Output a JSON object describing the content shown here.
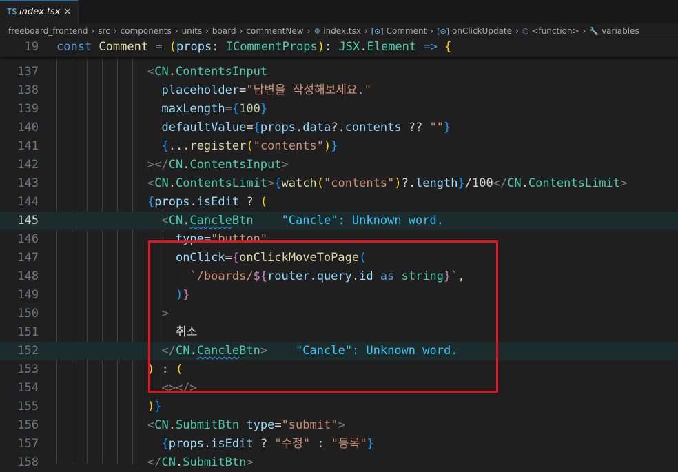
{
  "tab": {
    "icon": "TS",
    "title": "index.tsx",
    "close": "×"
  },
  "breadcrumb": [
    {
      "label": "freeboard_frontend",
      "icon": ""
    },
    {
      "label": "src",
      "icon": ""
    },
    {
      "label": "components",
      "icon": ""
    },
    {
      "label": "units",
      "icon": ""
    },
    {
      "label": "board",
      "icon": ""
    },
    {
      "label": "commentNew",
      "icon": ""
    },
    {
      "label": "index.tsx",
      "icon": "⚙"
    },
    {
      "label": "Comment",
      "icon": "[⊙]"
    },
    {
      "label": "onClickUpdate",
      "icon": "[⊙]"
    },
    {
      "label": "<function>",
      "icon": "⬡"
    },
    {
      "label": "variables",
      "icon": "🔧"
    }
  ],
  "editor": {
    "line_numbers": [
      "19",
      "137",
      "138",
      "139",
      "140",
      "141",
      "142",
      "143",
      "144",
      "145",
      "146",
      "147",
      "148",
      "149",
      "150",
      "151",
      "152",
      "153",
      "154",
      "155",
      "156",
      "157",
      "158"
    ],
    "active_line": "145",
    "lines": [
      [
        [
          "k",
          "const "
        ],
        [
          "f",
          "Comment"
        ],
        [
          "w",
          " = "
        ],
        [
          "b1",
          "("
        ],
        [
          "v",
          "props"
        ],
        [
          "w",
          ": "
        ],
        [
          "t",
          "ICommentProps"
        ],
        [
          "b1",
          ")"
        ],
        [
          "w",
          ": "
        ],
        [
          "t",
          "JSX"
        ],
        [
          "w",
          "."
        ],
        [
          "t",
          "Element"
        ],
        [
          "w",
          " "
        ],
        [
          "k",
          "=>"
        ],
        [
          "w",
          " "
        ],
        [
          "b1",
          "{"
        ]
      ],
      [
        [
          "p",
          "<"
        ],
        [
          "t",
          "CN"
        ],
        [
          "w",
          "."
        ],
        [
          "t",
          "ContentsInput"
        ]
      ],
      [
        [
          "w",
          "  "
        ],
        [
          "v",
          "placeholder"
        ],
        [
          "w",
          "="
        ],
        [
          "s",
          "\"답변을 작성해보세요.\""
        ]
      ],
      [
        [
          "w",
          "  "
        ],
        [
          "v",
          "maxLength"
        ],
        [
          "w",
          "="
        ],
        [
          "b3",
          "{"
        ],
        [
          "n",
          "100"
        ],
        [
          "b3",
          "}"
        ]
      ],
      [
        [
          "w",
          "  "
        ],
        [
          "v",
          "defaultValue"
        ],
        [
          "w",
          "="
        ],
        [
          "b3",
          "{"
        ],
        [
          "v",
          "props"
        ],
        [
          "w",
          "."
        ],
        [
          "v",
          "data"
        ],
        [
          "w",
          "?."
        ],
        [
          "v",
          "contents"
        ],
        [
          "w",
          " ?? "
        ],
        [
          "s",
          "\"\""
        ],
        [
          "b3",
          "}"
        ]
      ],
      [
        [
          "w",
          "  "
        ],
        [
          "b3",
          "{"
        ],
        [
          "w",
          "..."
        ],
        [
          "f",
          "register"
        ],
        [
          "b1",
          "("
        ],
        [
          "s",
          "\"contents\""
        ],
        [
          "b1",
          ")"
        ],
        [
          "b3",
          "}"
        ]
      ],
      [
        [
          "p",
          "></"
        ],
        [
          "t",
          "CN"
        ],
        [
          "w",
          "."
        ],
        [
          "t",
          "ContentsInput"
        ],
        [
          "p",
          ">"
        ]
      ],
      [
        [
          "p",
          "<"
        ],
        [
          "t",
          "CN"
        ],
        [
          "w",
          "."
        ],
        [
          "t",
          "ContentsLimit"
        ],
        [
          "p",
          ">"
        ],
        [
          "b3",
          "{"
        ],
        [
          "f",
          "watch"
        ],
        [
          "b1",
          "("
        ],
        [
          "s",
          "\"contents\""
        ],
        [
          "b1",
          ")"
        ],
        [
          "w",
          "?."
        ],
        [
          "v",
          "length"
        ],
        [
          "b3",
          "}"
        ],
        [
          "w",
          "/100"
        ],
        [
          "p",
          "</"
        ],
        [
          "t",
          "CN"
        ],
        [
          "w",
          "."
        ],
        [
          "t",
          "ContentsLimit"
        ],
        [
          "p",
          ">"
        ]
      ],
      [
        [
          "b3",
          "{"
        ],
        [
          "v",
          "props"
        ],
        [
          "w",
          "."
        ],
        [
          "v",
          "isEdit"
        ],
        [
          "w",
          " ? "
        ],
        [
          "b1",
          "("
        ]
      ],
      [
        [
          "w",
          "  "
        ],
        [
          "p",
          "<"
        ],
        [
          "t",
          "CN"
        ],
        [
          "w",
          "."
        ],
        [
          "t squig",
          "Cancle"
        ],
        [
          "t",
          "Btn"
        ],
        [
          "w",
          "    "
        ],
        [
          "diag",
          "\"Cancle\": Unknown word."
        ]
      ],
      [
        [
          "w",
          "    "
        ],
        [
          "v",
          "type"
        ],
        [
          "w",
          "="
        ],
        [
          "s",
          "\"button\""
        ]
      ],
      [
        [
          "w",
          "    "
        ],
        [
          "v",
          "onClick"
        ],
        [
          "w",
          "="
        ],
        [
          "b2",
          "{"
        ],
        [
          "f",
          "onClickMoveToPage"
        ],
        [
          "b3",
          "("
        ]
      ],
      [
        [
          "w",
          "      "
        ],
        [
          "s",
          "`/boards/"
        ],
        [
          "ctl",
          "${"
        ],
        [
          "v",
          "router"
        ],
        [
          "w",
          "."
        ],
        [
          "v",
          "query"
        ],
        [
          "w",
          "."
        ],
        [
          "v",
          "id"
        ],
        [
          "w",
          " "
        ],
        [
          "k",
          "as"
        ],
        [
          "w",
          " "
        ],
        [
          "t",
          "string"
        ],
        [
          "ctl",
          "}"
        ],
        [
          "s",
          "`"
        ],
        [
          "w",
          ","
        ]
      ],
      [
        [
          "w",
          "    "
        ],
        [
          "b3",
          ")"
        ],
        [
          "b2",
          "}"
        ]
      ],
      [
        [
          "w",
          "  "
        ],
        [
          "p",
          ">"
        ]
      ],
      [
        [
          "w",
          "    취소"
        ]
      ],
      [
        [
          "w",
          "  "
        ],
        [
          "p",
          "</"
        ],
        [
          "t",
          "CN"
        ],
        [
          "w",
          "."
        ],
        [
          "t squig",
          "Cancle"
        ],
        [
          "t",
          "Btn"
        ],
        [
          "p",
          ">"
        ],
        [
          "w",
          "    "
        ],
        [
          "diag",
          "\"Cancle\": Unknown word."
        ]
      ],
      [
        [
          "b1",
          ")"
        ],
        [
          "w",
          " : "
        ],
        [
          "b1",
          "("
        ]
      ],
      [
        [
          "w",
          "  "
        ],
        [
          "p",
          "<></>"
        ]
      ],
      [
        [
          "b1",
          ")"
        ],
        [
          "b3",
          "}"
        ]
      ],
      [
        [
          "p",
          "<"
        ],
        [
          "t",
          "CN"
        ],
        [
          "w",
          "."
        ],
        [
          "t",
          "SubmitBtn"
        ],
        [
          "w",
          " "
        ],
        [
          "v",
          "type"
        ],
        [
          "w",
          "="
        ],
        [
          "s",
          "\"submit\""
        ],
        [
          "p",
          ">"
        ]
      ],
      [
        [
          "w",
          "  "
        ],
        [
          "b3",
          "{"
        ],
        [
          "v",
          "props"
        ],
        [
          "w",
          "."
        ],
        [
          "v",
          "isEdit"
        ],
        [
          "w",
          " ? "
        ],
        [
          "s",
          "\"수정\""
        ],
        [
          "w",
          " : "
        ],
        [
          "s",
          "\"등록\""
        ],
        [
          "b3",
          "}"
        ]
      ],
      [
        [
          "p",
          "</"
        ],
        [
          "t",
          "CN"
        ],
        [
          "w",
          "."
        ],
        [
          "t",
          "SubmitBtn"
        ],
        [
          "p",
          ">"
        ]
      ]
    ]
  }
}
